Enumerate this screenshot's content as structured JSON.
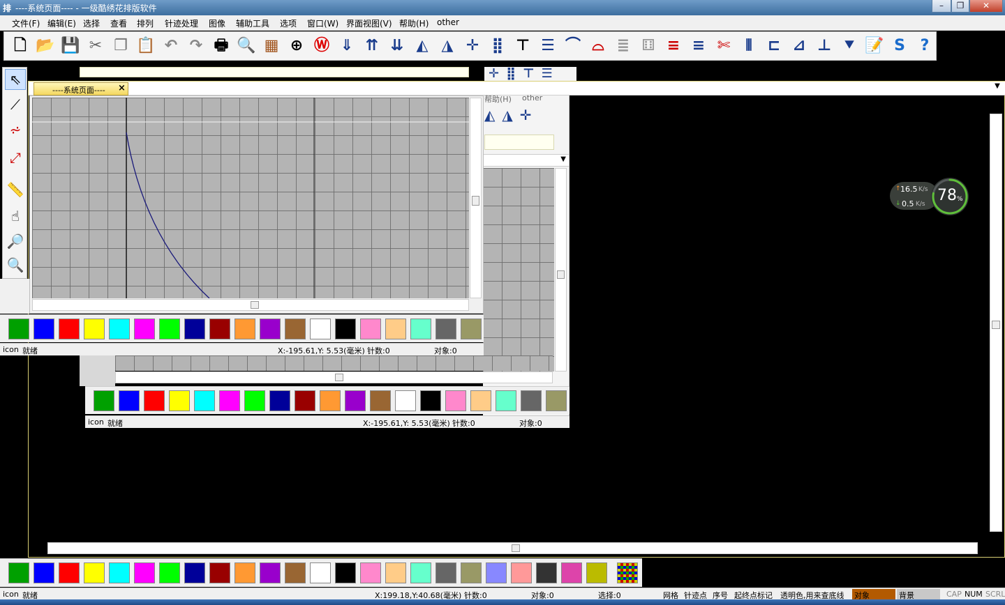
{
  "window": {
    "title": "----系统页面---- - 一级酷绣花排版软件",
    "app_icon_label": "排"
  },
  "menu": [
    {
      "label": "文件(F)"
    },
    {
      "label": "编辑(E)"
    },
    {
      "label": "选择"
    },
    {
      "label": "查看"
    },
    {
      "label": "排列"
    },
    {
      "label": "针迹处理"
    },
    {
      "label": "图像"
    },
    {
      "label": "辅助工具"
    },
    {
      "label": "选项"
    },
    {
      "label": "窗口(W)"
    },
    {
      "label": "界面视图(V)"
    },
    {
      "label": "帮助(H)"
    },
    {
      "label": "other"
    }
  ],
  "toolbar_icons": [
    "new-file-icon",
    "open-folder-icon",
    "save-icon",
    "cut-icon",
    "copy-icon",
    "paste-icon",
    "undo-icon",
    "redo-icon",
    "print-icon",
    "print-preview-icon",
    "stitch-machine-icon",
    "crosshair-icon",
    "emblem-icon",
    "save-down-icon",
    "import-stitch-icon",
    "export-stitch-icon",
    "mirror-horizontal-icon",
    "mirror-vertical-icon",
    "center-point-icon",
    "dot-grid-icon",
    "align-top-icon",
    "distribute-icon",
    "arc-icon",
    "arc-red-icon",
    "list-gray-icon",
    "dice-icon",
    "bars-red-blue-icon",
    "bars-blue-red-icon",
    "cut-stitch-icon",
    "jump-icon",
    "align-left-icon",
    "align-bottom-left-icon",
    "align-bottom-icon",
    "node-down-icon",
    "note-icon",
    "s-logo-icon",
    "help-icon"
  ],
  "left_tools": [
    "select-arrow-icon",
    "node-edit-icon",
    "stitch-select-icon",
    "stitch-line-icon",
    "ruler-icon",
    "hand-pan-icon",
    "zoom-in-icon",
    "zoom-out-icon"
  ],
  "tab": {
    "label": "----系统页面----",
    "close": "×"
  },
  "ghost_menu": {
    "left": "帮助(H)",
    "right": "other"
  },
  "colors": [
    "#00a000",
    "#0000ff",
    "#ff0000",
    "#ffff00",
    "#00ffff",
    "#ff00ff",
    "#00ff00",
    "#000099",
    "#990000",
    "#ff9933",
    "#9900cc",
    "#996633",
    "#ffffff",
    "#000000",
    "#ff88cc",
    "#ffcc88",
    "#66ffcc",
    "#666666",
    "#999966"
  ],
  "bottom_colors": [
    "#00a000",
    "#0000ff",
    "#ff0000",
    "#ffff00",
    "#00ffff",
    "#ff00ff",
    "#00ff00",
    "#000099",
    "#990000",
    "#ff9933",
    "#9900cc",
    "#996633",
    "#ffffff",
    "#000000",
    "#ff88cc",
    "#ffcc88",
    "#66ffcc",
    "#666666",
    "#999966",
    "#8888ff",
    "#ff9999",
    "#333333",
    "#dd44aa",
    "#bbbb00"
  ],
  "status_small": {
    "icon": "icon",
    "ready": "就绪",
    "coords": "X:-195.61,Y: 5.53(毫米)",
    "stitches": "针数:0",
    "objects": "对象:0"
  },
  "status_main": {
    "icon": "icon",
    "ready": "就绪",
    "coords": "X:199.18,Y:40.68(毫米)",
    "stitches": "针数:0",
    "objects": "对象:0",
    "selected": "选择:0",
    "grid": "网格",
    "stitch_point": "针迹点",
    "sequence": "序号",
    "start_end": "起终点标记",
    "transparent": "透明色,用来查底线",
    "object_chip": "对象",
    "background_chip": "背景",
    "cap": "CAP",
    "num": "NUM",
    "scrl": "SCRL"
  },
  "network": {
    "upload": "16.5",
    "download": "0.5",
    "unit": "K/s",
    "percent": "78",
    "percent_sign": "%",
    "percent_value": 0.78
  }
}
